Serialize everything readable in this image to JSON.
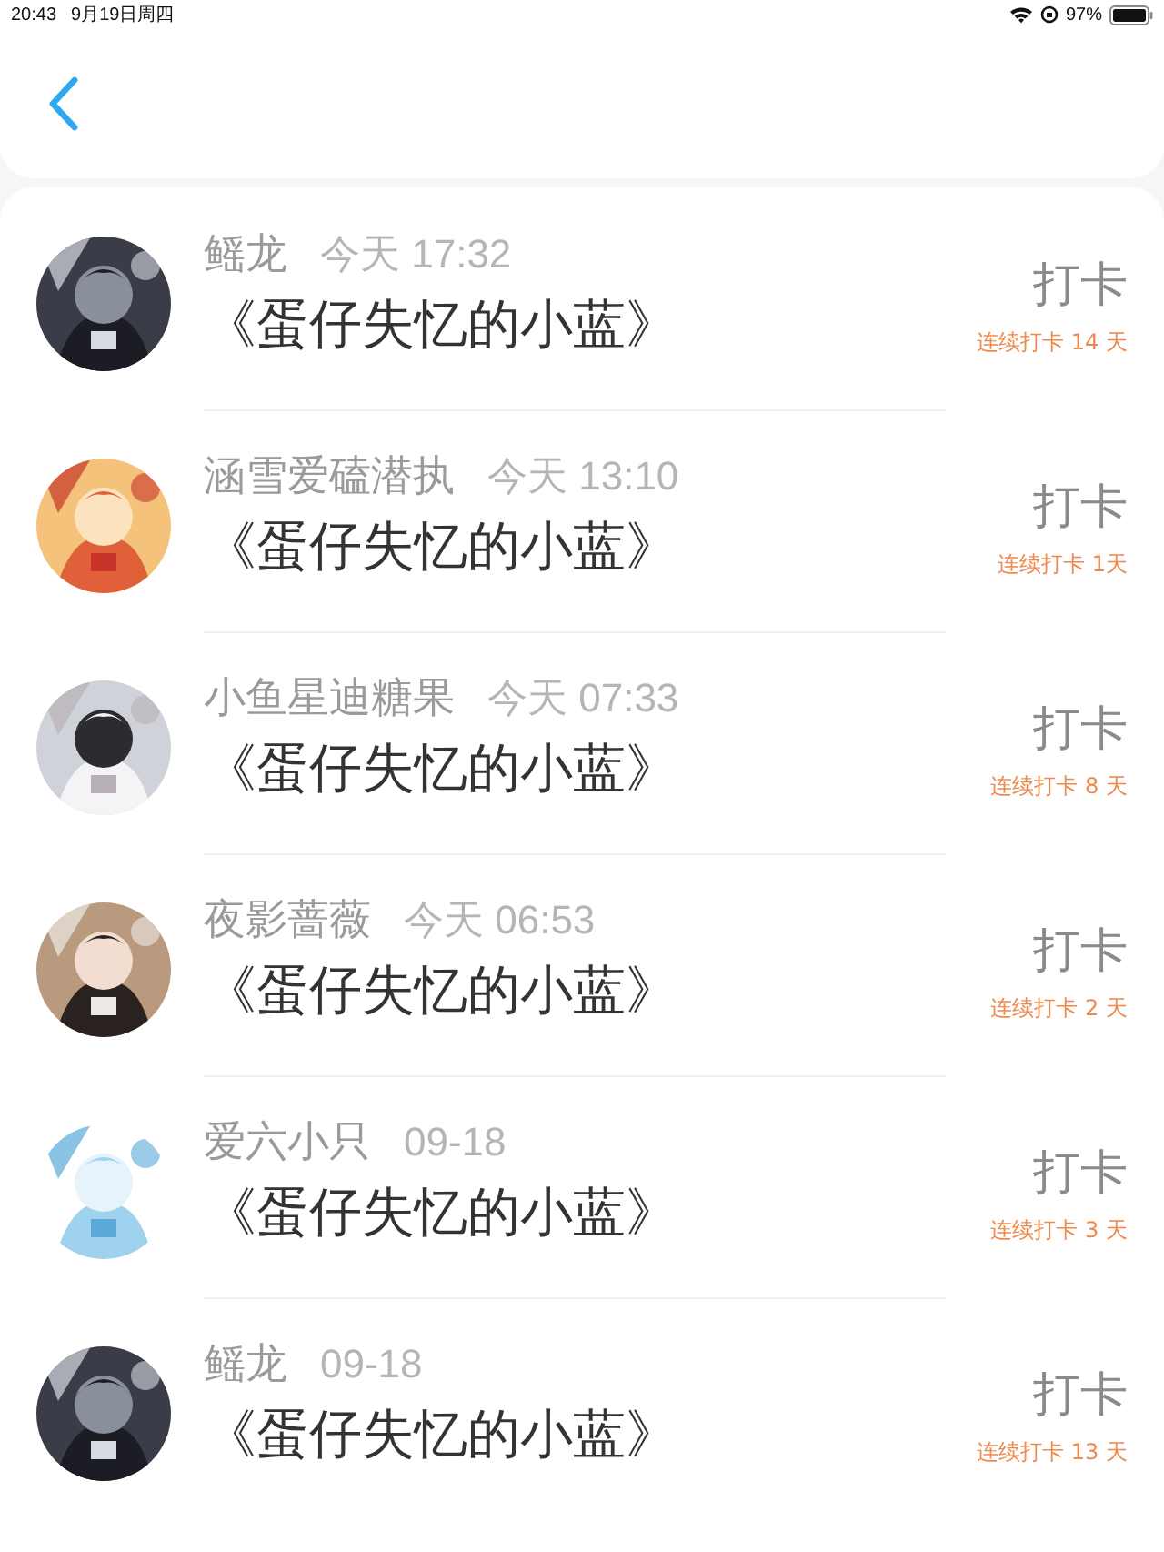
{
  "status_bar": {
    "time": "20:43",
    "date": "9月19日周四",
    "battery": "97%"
  },
  "entries": [
    {
      "name": "鳐龙",
      "time": "今天 17:32",
      "title": "《蛋仔失忆的小蓝》",
      "action": "打卡",
      "streak": "连续打卡 14 天"
    },
    {
      "name": "涵雪爱磕潜执",
      "time": "今天 13:10",
      "title": "《蛋仔失忆的小蓝》",
      "action": "打卡",
      "streak": "连续打卡 1天"
    },
    {
      "name": "小鱼星迪糖果",
      "time": "今天 07:33",
      "title": "《蛋仔失忆的小蓝》",
      "action": "打卡",
      "streak": "连续打卡 8 天"
    },
    {
      "name": "夜影蔷薇",
      "time": "今天 06:53",
      "title": "《蛋仔失忆的小蓝》",
      "action": "打卡",
      "streak": "连续打卡 2 天"
    },
    {
      "name": "爱六小只",
      "time": "09-18",
      "title": "《蛋仔失忆的小蓝》",
      "action": "打卡",
      "streak": "连续打卡 3 天"
    },
    {
      "name": "鳐龙",
      "time": "09-18",
      "title": "《蛋仔失忆的小蓝》",
      "action": "打卡",
      "streak": "连续打卡 13 天"
    }
  ]
}
